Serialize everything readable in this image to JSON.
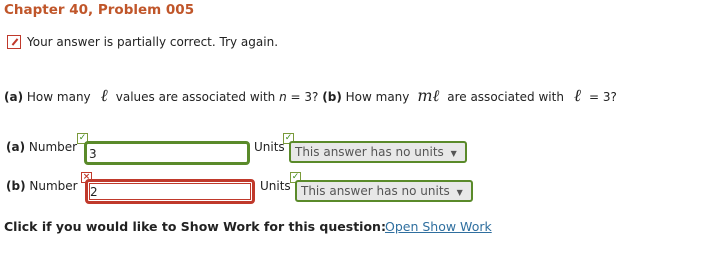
{
  "header": {
    "title": "Chapter 40, Problem 005"
  },
  "status": {
    "message": "Your answer is partially correct.  Try again."
  },
  "question": {
    "a_label": "(a)",
    "a_text_1": "How many",
    "ell_symbol": "ℓ",
    "a_text_2": "values are associated with",
    "n_var": "n",
    "a_text_3": "= 3?",
    "b_label": "(b)",
    "b_text_1": "How many",
    "ml_symbol": "mℓ",
    "b_text_2": "are associated with",
    "ell_symbol_2": "ℓ",
    "b_text_3": "= 3?"
  },
  "part_a": {
    "label": "(a)",
    "number_label": "Number",
    "value": "3",
    "units_label": "Units",
    "units_value": "This answer has no units",
    "units_arrow": "▼"
  },
  "part_b": {
    "label": "(b)",
    "number_label": "Number",
    "value": "2",
    "units_label": "Units",
    "units_value": "This answer has no units",
    "units_arrow": "▼"
  },
  "marks": {
    "check": "✓",
    "cross": "×"
  },
  "show_work": {
    "prompt": "Click if you would like to Show Work for this question:",
    "link": "Open Show Work"
  },
  "colors": {
    "title": "#c0562a",
    "correct": "#5a8a2a",
    "incorrect": "#c0392b",
    "link": "#2f6f9f"
  }
}
